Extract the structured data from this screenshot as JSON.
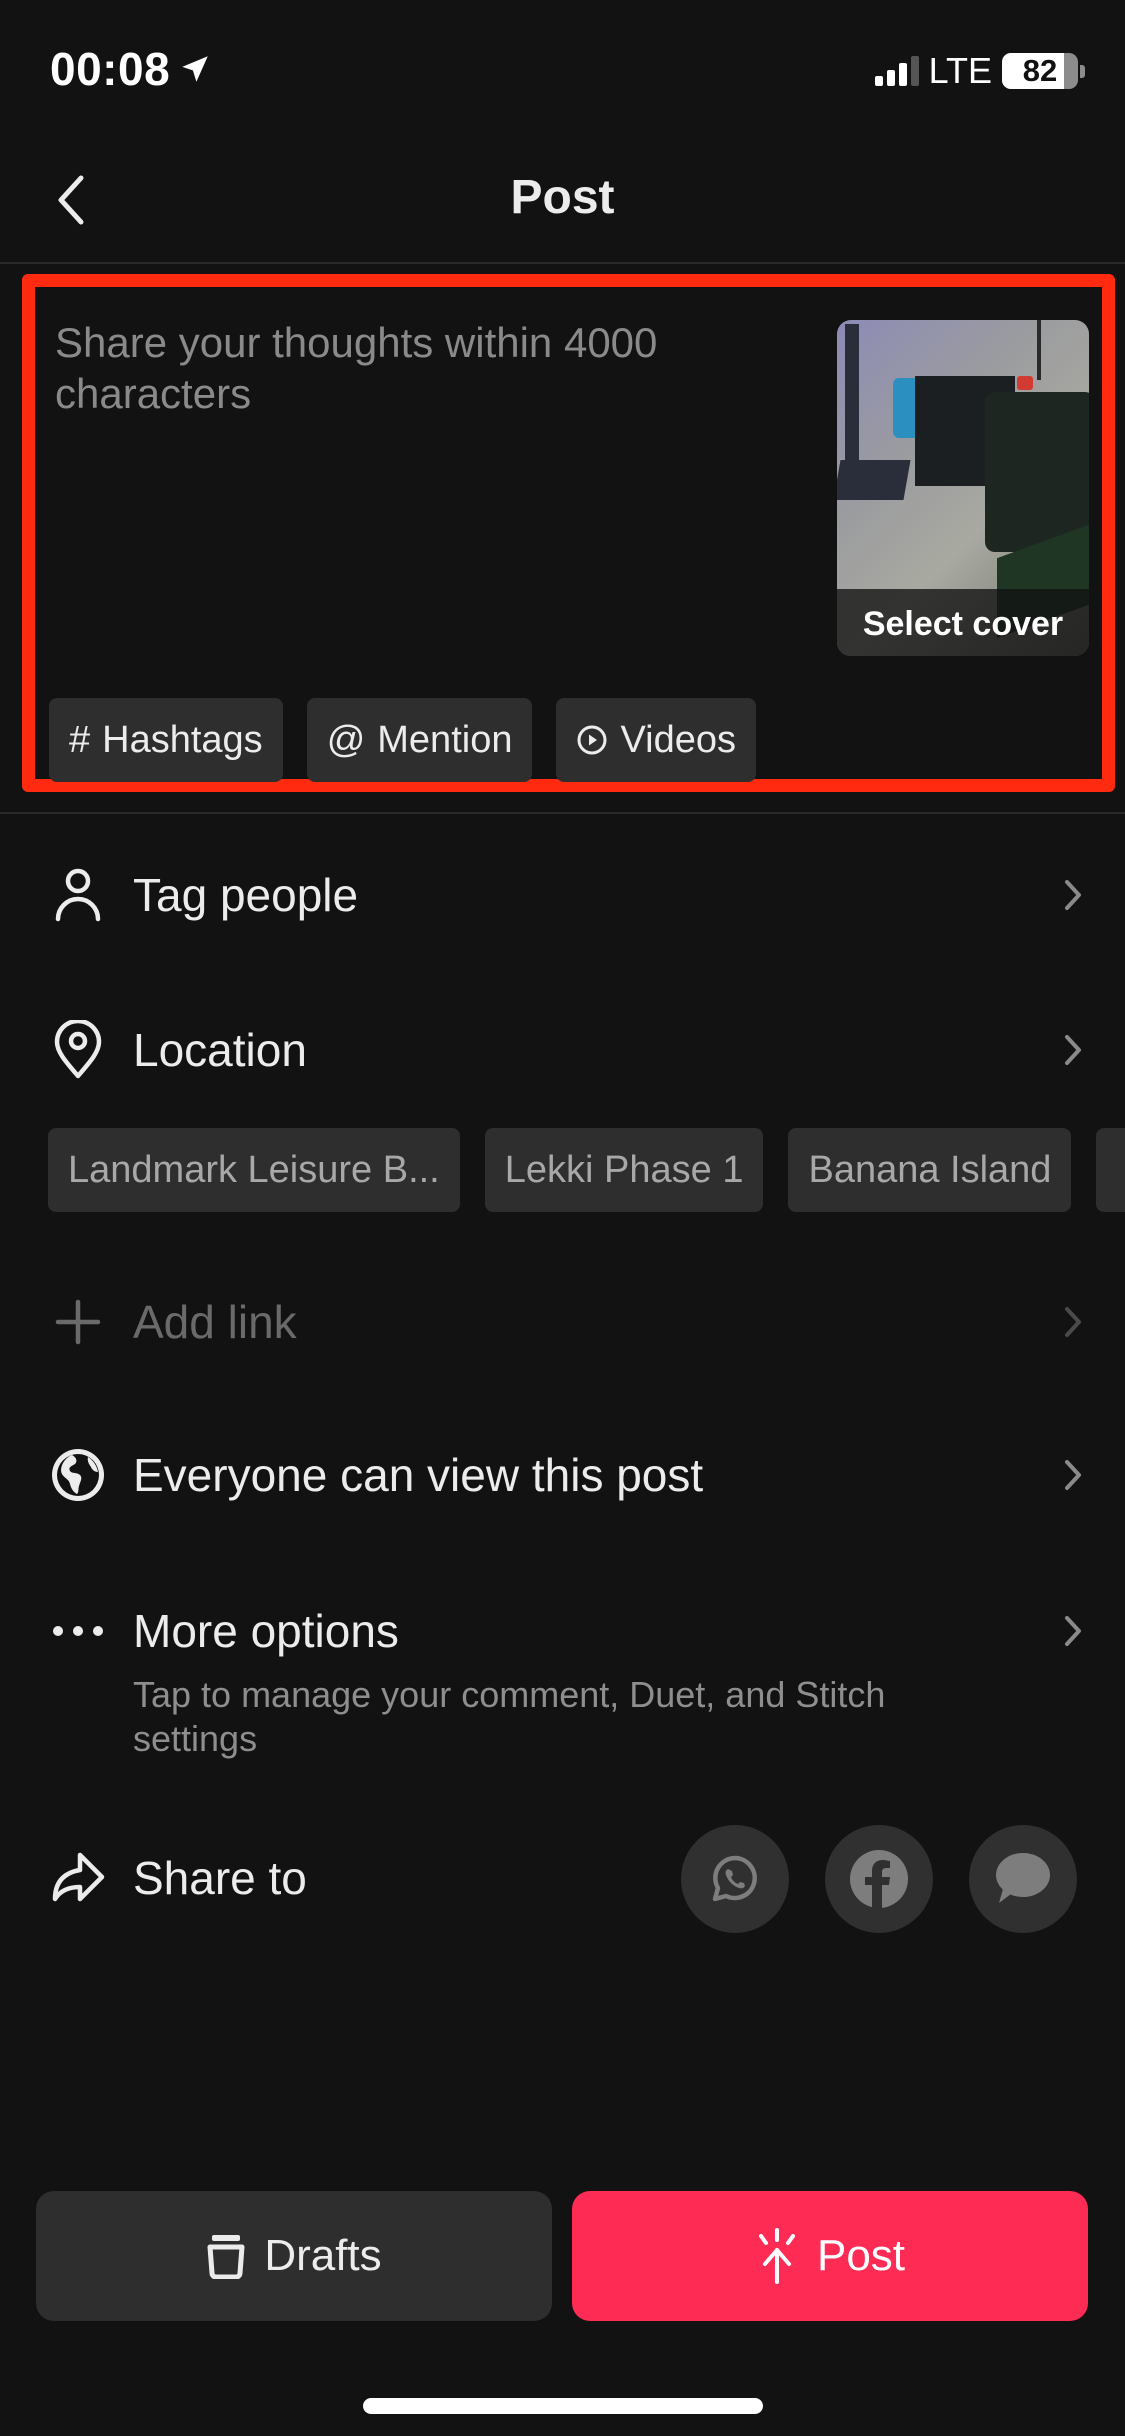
{
  "status_bar": {
    "time": "00:08",
    "location_icon": "location-arrow-icon",
    "network": "LTE",
    "signal_bars_active": 3,
    "signal_bars_total": 4,
    "battery_percent": 82
  },
  "nav": {
    "back_icon": "chevron-left-icon",
    "title": "Post"
  },
  "composer": {
    "caption_value": "",
    "caption_placeholder": "Share your thoughts within 4000 characters",
    "cover_label": "Select cover",
    "highlight_color": "#ff2a10",
    "chips": [
      {
        "icon": "hash-icon",
        "glyph": "#",
        "label": "Hashtags"
      },
      {
        "icon": "at-icon",
        "glyph": "@",
        "label": "Mention"
      },
      {
        "icon": "play-circle-icon",
        "glyph": "",
        "label": "Videos"
      }
    ]
  },
  "rows": {
    "tag_people": {
      "icon": "person-icon",
      "label": "Tag people"
    },
    "location": {
      "icon": "location-pin-icon",
      "label": "Location",
      "suggestions": [
        "Landmark Leisure B...",
        "Lekki Phase 1",
        "Banana Island"
      ]
    },
    "add_link": {
      "icon": "plus-icon",
      "label": "Add link",
      "disabled": true
    },
    "privacy": {
      "icon": "globe-icon",
      "label": "Everyone can view this post"
    },
    "more_options": {
      "icon": "more-dots-icon",
      "label": "More options",
      "description": "Tap to manage your comment, Duet, and Stitch settings"
    },
    "share_to": {
      "icon": "share-arrow-icon",
      "label": "Share to",
      "targets": [
        {
          "name": "WhatsApp",
          "icon": "whatsapp-icon"
        },
        {
          "name": "Facebook",
          "icon": "facebook-icon"
        },
        {
          "name": "Messages",
          "icon": "message-bubble-icon"
        }
      ]
    }
  },
  "actions": {
    "drafts_label": "Drafts",
    "drafts_icon": "drafts-box-icon",
    "post_label": "Post",
    "post_icon": "post-upload-icon",
    "post_color": "#fe2c55"
  }
}
